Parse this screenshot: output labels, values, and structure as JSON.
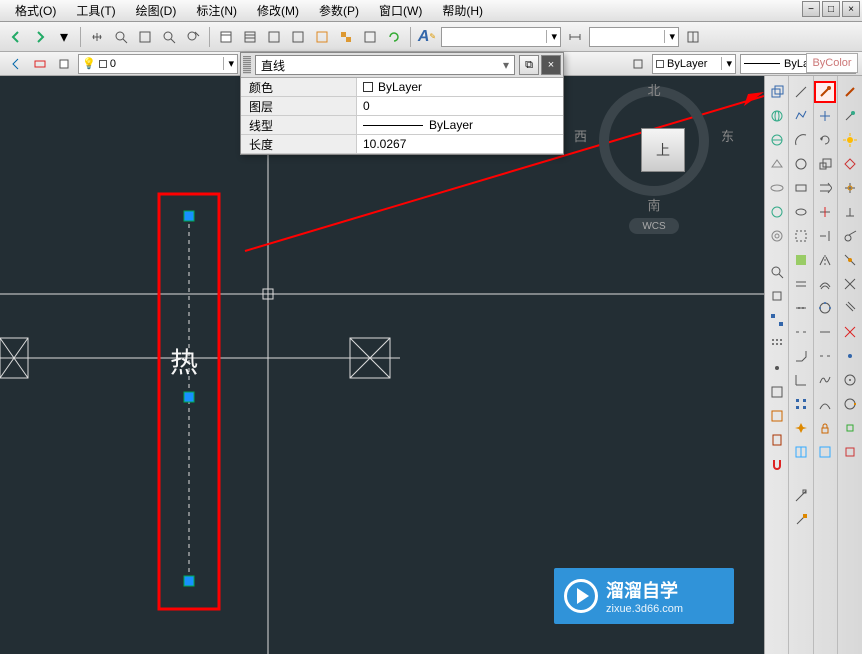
{
  "menu": {
    "format": "格式(O)",
    "tools": "工具(T)",
    "draw": "绘图(D)",
    "annotate": "标注(N)",
    "modify": "修改(M)",
    "params": "参数(P)",
    "window": "窗口(W)",
    "help": "帮助(H)"
  },
  "layer": {
    "current": "0"
  },
  "bylayer": {
    "color": "ByLayer",
    "linetype": "ByLayer",
    "bycolor": "ByColor"
  },
  "prop_panel": {
    "entity_type": "直线",
    "rows": {
      "color_label": "颜色",
      "color_value": "ByLayer",
      "layer_label": "图层",
      "layer_value": "0",
      "linetype_label": "线型",
      "linetype_value": "ByLayer",
      "length_label": "长度",
      "length_value": "10.0267"
    }
  },
  "nav": {
    "n": "北",
    "s": "南",
    "e": "东",
    "w": "西",
    "top": "上",
    "wcs": "WCS"
  },
  "canvas": {
    "label_text": "热"
  },
  "watermark": {
    "main": "溜溜自学",
    "sub": "zixue.3d66.com"
  },
  "chart_data": {
    "type": "diagram",
    "description": "CAD drawing canvas showing a selected vertical dashed line with grip handles",
    "selected_entity": {
      "type": "line",
      "style": "dashed",
      "grip_points": [
        {
          "role": "endpoint",
          "state": "normal"
        },
        {
          "role": "midpoint",
          "state": "normal"
        },
        {
          "role": "endpoint",
          "state": "normal"
        }
      ],
      "length": 10.0267,
      "layer": "0",
      "color": "ByLayer",
      "linetype": "ByLayer"
    },
    "text_entities": [
      {
        "text": "热",
        "position": "near midpoint of selected line"
      }
    ],
    "annotations": [
      {
        "type": "red-rectangle",
        "around": "selected vertical line"
      },
      {
        "type": "red-arrow",
        "from": "selected line lower area",
        "to": "highlighted tool in top-right toolbar"
      }
    ],
    "other_geometry": [
      {
        "type": "crosshair",
        "note": "full-width horizontal and vertical crosshair lines"
      },
      {
        "type": "square-with-diagonals",
        "count": 2,
        "note": "two small squares with X crosses on horizontal line"
      }
    ]
  }
}
